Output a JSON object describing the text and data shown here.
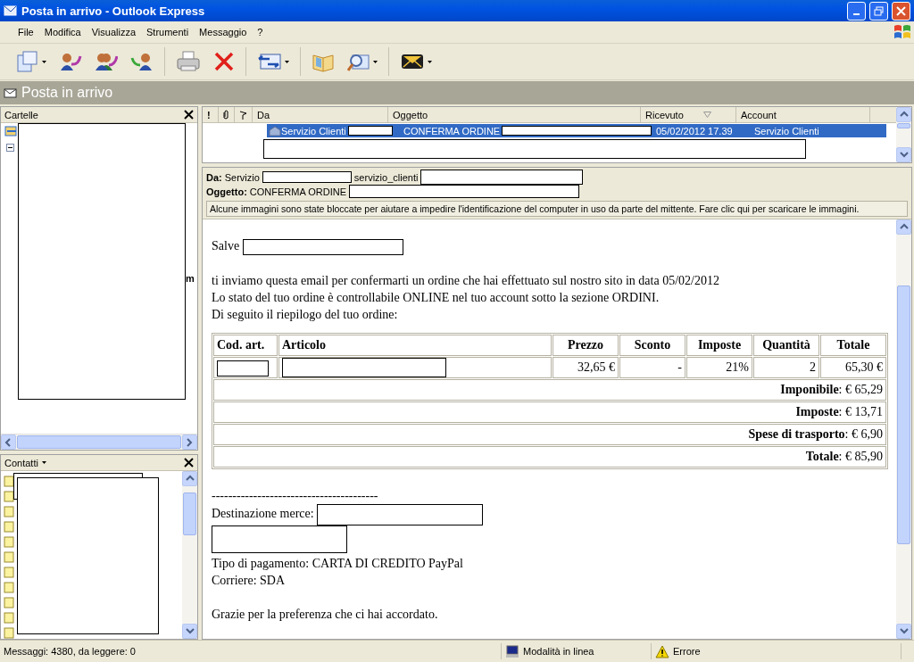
{
  "window": {
    "title": "Posta in arrivo - Outlook Express"
  },
  "menu": [
    "File",
    "Modifica",
    "Visualizza",
    "Strumenti",
    "Messaggio",
    "?"
  ],
  "toolbar": [
    {
      "kind": "compose",
      "dropdown": true
    },
    {
      "kind": "reply",
      "dropdown": false
    },
    {
      "kind": "reply_all",
      "dropdown": false
    },
    {
      "kind": "forward",
      "dropdown": false
    },
    {
      "kind": "separator"
    },
    {
      "kind": "print",
      "dropdown": false
    },
    {
      "kind": "delete",
      "dropdown": false
    },
    {
      "kind": "separator"
    },
    {
      "kind": "send_receive",
      "dropdown": true
    },
    {
      "kind": "separator"
    },
    {
      "kind": "addresses",
      "dropdown": false
    },
    {
      "kind": "find",
      "dropdown": true
    },
    {
      "kind": "separator"
    },
    {
      "kind": "messenger",
      "dropdown": true
    }
  ],
  "folder_bar": {
    "title": "Posta in arrivo"
  },
  "folders_pane": {
    "title": "Cartelle",
    "tree_fragment": "m"
  },
  "contacts_pane": {
    "title": "Contatti"
  },
  "message_list": {
    "columns": [
      {
        "kind": "priority",
        "label": "!"
      },
      {
        "kind": "attachment"
      },
      {
        "kind": "flag"
      },
      {
        "kind": "text",
        "label": "Da",
        "sorted": false
      },
      {
        "kind": "text",
        "label": "Oggetto",
        "sorted": false
      },
      {
        "kind": "text",
        "label": "Ricevuto",
        "sorted": true
      },
      {
        "kind": "text",
        "label": "Account",
        "sorted": false
      }
    ],
    "rows": [
      {
        "from": "Servizio Clienti",
        "subject": "CONFERMA ORDINE",
        "received": "05/02/2012 17.39",
        "account": "Servizio Clienti",
        "selected": true
      }
    ]
  },
  "preview": {
    "from_label": "Da:",
    "from": "Servizio",
    "email": "servizio_clienti",
    "subject_label": "Oggetto:",
    "subject": "CONFERMA ORDINE",
    "notice": "Alcune immagini sono state bloccate per aiutare a impedire l'identificazione del computer in uso da parte del mittente. Fare clic qui per scaricare le immagini."
  },
  "body": {
    "greeting": "Salve",
    "paragraphs": [
      "ti inviamo questa email per confermarti un ordine che hai effettuato sul nostro sito in data 05/02/2012",
      "Lo stato del tuo ordine è controllabile ONLINE nel tuo account sotto la sezione ORDINI.",
      "Di seguito il riepilogo del tuo ordine:"
    ],
    "order_table": {
      "columns": [
        "Cod. art.",
        "Articolo",
        "Prezzo",
        "Sconto",
        "Imposte",
        "Quantità",
        "Totale"
      ],
      "item": {
        "price": "32,65 €",
        "discount": "-",
        "tax": "21%",
        "quantity": "2",
        "total": "65,30 €"
      },
      "summary": [
        "**Imponibile**: € 65,29",
        "**Imposte**: € 13,71",
        "**Spese di trasporto**: € 6,90",
        "**Totale**: € 85,90"
      ]
    },
    "separator": "----------------------------------------",
    "shipping_label": "Destinazione merce:",
    "payment": "Tipo di pagamento: CARTA DI CREDITO PayPal",
    "courier": "Corriere: SDA",
    "closing": "Grazie per la preferenza che ci hai accordato."
  },
  "status_bar": {
    "count": "Messaggi: 4380, da leggere: 0",
    "mode": "Modalità in linea",
    "error": "Errore"
  }
}
